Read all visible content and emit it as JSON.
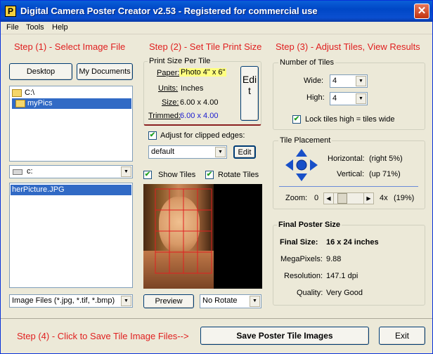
{
  "window": {
    "title": "Digital Camera Poster Creator v2.53 - Registered for commercial use",
    "app_icon_letter": "P",
    "close_glyph": "✕"
  },
  "menu": [
    "File",
    "Tools",
    "Help"
  ],
  "steps": {
    "step1": "Step (1) - Select Image File",
    "step2": "Step (2) - Set Tile Print Size",
    "step3": "Step (3) - Adjust Tiles, View Results",
    "step4": "Step (4) - Click to Save Tile Image Files-->"
  },
  "file_panel": {
    "desktop_button": "Desktop",
    "mydocs_button": "My Documents",
    "folders": [
      {
        "label": "C:\\",
        "selected": false
      },
      {
        "label": "myPics",
        "selected": true
      }
    ],
    "drive": "c:",
    "files": [
      "herPicture.JPG"
    ],
    "filter": "Image Files (*.jpg, *.tif, *.bmp)"
  },
  "print_size": {
    "group_label": "Print Size Per Tile",
    "paper_label": "Paper:",
    "paper_value": "Photo 4\" x 6\"",
    "units_label": "Units:",
    "units_value": "Inches",
    "size_label": "Size:",
    "size_value": "6.00 x 4.00",
    "trimmed_label": "Trimmed:",
    "trimmed_value": "6.00 x 4.00",
    "edit_vertical": "Edit",
    "adjust_label": "Adjust for clipped edges:",
    "adjust_checked": true,
    "adjust_preset": "default",
    "edit_small": "Edit"
  },
  "preview_opts": {
    "show_tiles": "Show Tiles",
    "show_tiles_checked": true,
    "rotate_tiles": "Rotate Tiles",
    "rotate_tiles_checked": true,
    "preview_button": "Preview",
    "rotate_select": "No Rotate"
  },
  "tiles": {
    "group_label": "Number of Tiles",
    "wide_label": "Wide:",
    "wide_value": "4",
    "high_label": "High:",
    "high_value": "4",
    "lock_label": "Lock tiles high = tiles wide",
    "lock_checked": true
  },
  "placement": {
    "group_label": "Tile Placement",
    "horizontal_label": "Horizontal:",
    "horizontal_value": "(right 5%)",
    "vertical_label": "Vertical:",
    "vertical_value": "(up 71%)",
    "zoom_label": "Zoom:",
    "zoom_min": "0",
    "zoom_max": "4x",
    "zoom_pct": "(19%)",
    "zoom_fraction": 0.19
  },
  "final": {
    "group_label": "Final Poster Size",
    "size_label": "Final Size:",
    "size_value": "16 x 24 inches",
    "mp_label": "MegaPixels:",
    "mp_value": "9.88",
    "res_label": "Resolution:",
    "res_value": "147.1 dpi",
    "quality_label": "Quality:",
    "quality_value": "Very Good"
  },
  "bottom": {
    "save_button": "Save Poster Tile Images",
    "exit_button": "Exit"
  },
  "colors": {
    "step_red": "#e02020",
    "trimmed_blue": "#1a1ad0",
    "paper_highlight": "#ffff80",
    "grid_red": "#e02020",
    "nav_blue": "#1850c8"
  }
}
